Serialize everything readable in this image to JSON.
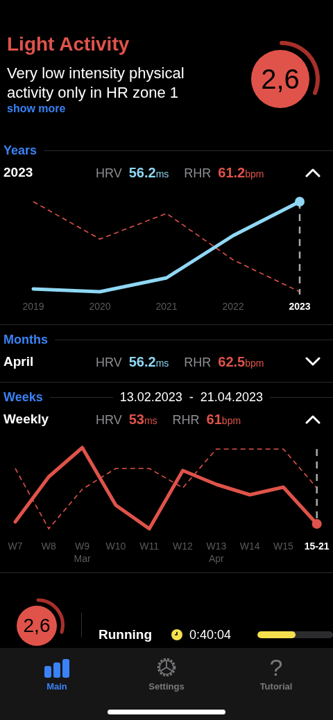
{
  "header": {
    "title": "Light Activity",
    "description": "Very low intensity physical activity only in HR zone 1",
    "show_more": "show more",
    "score": "2,6"
  },
  "sections": [
    {
      "label": "Years",
      "period": "2023",
      "expanded": true,
      "metrics": [
        {
          "label": "HRV",
          "value": "56.2",
          "unit": "ms",
          "kind": "good"
        },
        {
          "label": "RHR",
          "value": "61.2",
          "unit": "bpm",
          "kind": "bad"
        }
      ],
      "x_labels": [
        {
          "label": "2019",
          "selected": false
        },
        {
          "label": "2020",
          "selected": false
        },
        {
          "label": "2021",
          "selected": false
        },
        {
          "label": "2022",
          "selected": false
        },
        {
          "label": "2023",
          "selected": true
        }
      ]
    },
    {
      "label": "Months",
      "period": "April",
      "expanded": false,
      "metrics": [
        {
          "label": "HRV",
          "value": "56.2",
          "unit": "ms",
          "kind": "good"
        },
        {
          "label": "RHR",
          "value": "62.5",
          "unit": "bpm",
          "kind": "bad"
        }
      ]
    },
    {
      "label": "Weeks",
      "range": {
        "start": "13.02.2023",
        "separator": "-",
        "end": "21.04.2023"
      },
      "period": "Weekly",
      "expanded": true,
      "metrics": [
        {
          "label": "HRV",
          "value": "53",
          "unit": "ms",
          "kind": "bad"
        },
        {
          "label": "RHR",
          "value": "61",
          "unit": "bpm",
          "kind": "bad"
        }
      ],
      "x_labels": [
        {
          "label": "W7",
          "selected": false
        },
        {
          "label": "W8",
          "selected": false
        },
        {
          "label": "W9",
          "sublabel": "Mar",
          "selected": false
        },
        {
          "label": "W10",
          "selected": false
        },
        {
          "label": "W11",
          "selected": false
        },
        {
          "label": "W12",
          "selected": false
        },
        {
          "label": "W13",
          "sublabel": "Apr",
          "selected": false
        },
        {
          "label": "W14",
          "selected": false
        },
        {
          "label": "W15",
          "selected": false
        },
        {
          "label": "15-21",
          "selected": true
        }
      ]
    }
  ],
  "activity": {
    "score": "2,6",
    "name": "Running",
    "duration": "0:40:04",
    "level": 0.5
  },
  "tabs": [
    {
      "label": "Main",
      "kind": "chart",
      "selected": true
    },
    {
      "label": "Settings",
      "kind": "settings",
      "selected": false
    },
    {
      "label": "Tutorial",
      "kind": "help",
      "glyph": "?",
      "selected": false
    }
  ]
}
